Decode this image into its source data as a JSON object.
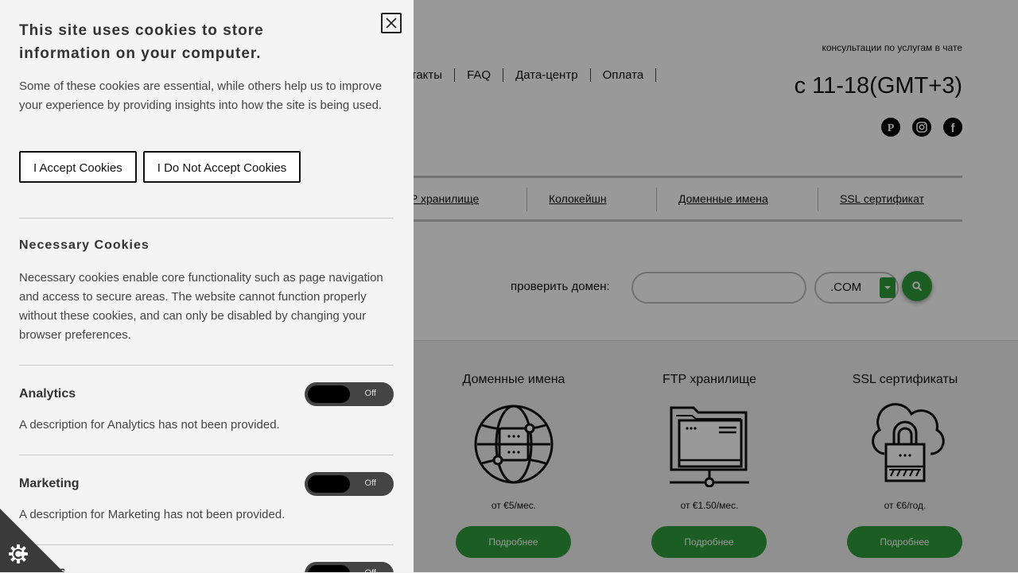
{
  "header": {
    "consult_text": "консультации по услугам в чате",
    "hours": "c 11-18(GMT+3)",
    "nav": [
      "онтакты",
      "FAQ",
      "Дата-центр",
      "Оплата"
    ],
    "social_icons": [
      "pinterest-icon",
      "instagram-icon",
      "facebook-icon"
    ]
  },
  "subnav": [
    "P хранилище",
    "Колокейшн",
    "Доменные имена",
    "SSL сертификат"
  ],
  "domain_search": {
    "label": "проверить домен:",
    "placeholder": "",
    "tld": ".COM"
  },
  "services": [
    {
      "title": "Доменные имена",
      "icon": "globe-server-icon",
      "price": "от €5/мес.",
      "button": "Подробнее"
    },
    {
      "title": "FTP хранилище",
      "icon": "folder-server-icon",
      "price": "от €1.50/мес.",
      "button": "Подробнее"
    },
    {
      "title": "SSL сертификаты",
      "icon": "cloud-lock-icon",
      "price": "от €6/год.",
      "button": "Подробнее"
    }
  ],
  "cookie_panel": {
    "title": "This site uses cookies to store information on your computer.",
    "intro": "Some of these cookies are essential, while others help us to improve your experience by providing insights into how the site is being used.",
    "accept_label": "I Accept Cookies",
    "reject_label": "I Do Not Accept Cookies",
    "necessary": {
      "title": "Necessary Cookies",
      "description": "Necessary cookies enable core functionality such as page navigation and access to secure areas. The website cannot function properly without these cookies, and can only be disabled by changing your browser preferences."
    },
    "categories": [
      {
        "label": "Analytics",
        "state": "Off",
        "description": "A description for Analytics has not been provided."
      },
      {
        "label": "Marketing",
        "state": "Off",
        "description": "A description for Marketing has not been provided."
      },
      {
        "label": "...ences",
        "state": "Off",
        "description": ""
      }
    ]
  },
  "colors": {
    "accent": "#2e9b39",
    "panel_bg": "#f4f4f4",
    "toggle_bg": "#444444"
  }
}
